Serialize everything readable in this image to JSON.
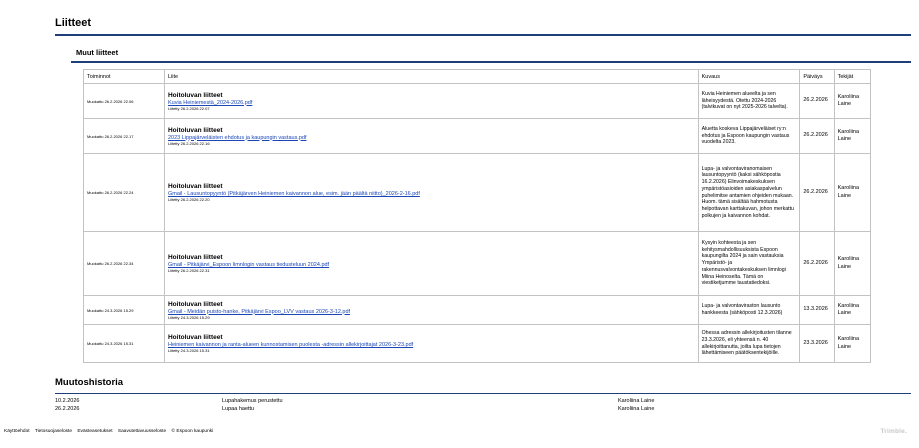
{
  "page": {
    "title": "Liitteet",
    "subtitle": "Muut liitteet"
  },
  "table": {
    "headers": [
      "Toiminnot",
      "Liite",
      "Kuvaus",
      "Päiväys",
      "Tekijät"
    ],
    "rows": [
      {
        "modified": "Muokattu 26.2.2026 22.06",
        "att_title": "Hoitoluvan liitteet",
        "att_link": "Kuvia Heiniemestä_2024-2026.pdf",
        "att_added": "Liitetty 26.2.2026 22.07",
        "desc": "Kuvia Heiniemen alueelta ja sen läheisyydestä. Otettu 2024-2026 (talvikuvat on nyt 2025-2026 talvelta).",
        "date": "26.2.2026",
        "author": "Karoliina Laine"
      },
      {
        "modified": "Muokattu 26.2.2026 22.17",
        "att_title": "Hoitoluvan liitteet",
        "att_link": "2023 Lippajärveläisten ehdotus ja kaupungin vastaus.pdf",
        "att_added": "Liitetty 26.2.2026 22.16",
        "desc": "Aluetta koskeva Lippajärveläiset ry:n ehdotus ja Espoon kaupungin vastaus vuodelta 2023.",
        "date": "26.2.2026",
        "author": "Karoliina Laine"
      },
      {
        "modified": "Muokattu 26.2.2026 22.24",
        "att_title": "Hoitoluvan liitteet",
        "att_link": "Gmail - Lausuntopyyntö (Pitkäjärven Heiniemen kaivannon alue, esim. jään päältä niitto)_2026-2-16.pdf",
        "att_added": "Liitetty 26.2.2026 22.20",
        "desc": "Lupa- ja valvontaviranomaisen lausuntopyyntö (kaksi sähköpostia 16.2.2026) Elinvoimakeskuksen ympäristöasioiden asiakaspalvelun puhelimitse antamien ohjeiden mukaan. Huom. tämä sisältää hahmotusta helpottavan karttakuvan, johon merkattu polkujen ja kaivannon kohdat.",
        "date": "26.2.2026",
        "author": "Karoliina Laine"
      },
      {
        "modified": "Muokattu 26.2.2026 22.34",
        "att_title": "Hoitoluvan liitteet",
        "att_link": "Gmail - Pitkäjärvi_Espoon limnlogin vastaus tiedusteluun 2024.pdf",
        "att_added": "Liitetty 26.2.2026 22.31",
        "desc": "Kysyin kohteesta ja sen kehitysmahdollisuuksista Espoon kaupungilta 2024 ja sain vastauksia Ympäristö- ja rakennusvalvontakeskuksen limnlogi Miina Heinoselta. Tämä on viestiketjumme taustatiedoksi.",
        "date": "26.2.2026",
        "author": "Karoliina Laine"
      },
      {
        "modified": "Muokattu 24.3.2026 15.29",
        "att_title": "Hoitoluvan liitteet",
        "att_link": "Gmail - Meidän puisto-hanke, Pitkäjärvi Espoo_LVV vastaus 2026-3-12.pdf",
        "att_added": "Liitetty 24.3.2026 15.29",
        "desc": "Lupa- ja valvontaviraston lausunto hankkeesta (sähköposti 12.3.2026)",
        "date": "13.3.2026",
        "author": "Karoliina Laine"
      },
      {
        "modified": "Muokattu 24.3.2026 15.31",
        "att_title": "Hoitoluvan liitteet",
        "att_link": "Heiniemen kaivannon ja ranta-alueen kunnostamisen puolesta -adressin allekirjoittajat 2026-3-23.pdf",
        "att_added": "Liitetty 24.3.2026 15.31",
        "desc": "Ohessa adressin allekirjoitusten tilanne 23.3.2026, eli yhteensä n. 40 allekirjoittanutta, joilta lupa tietojen lähettämiseen päätöksentekijöille.",
        "date": "23.3.2026",
        "author": "Karoliina Laine"
      }
    ]
  },
  "history": {
    "title": "Muutoshistoria",
    "rows": [
      {
        "date": "10.2.2026",
        "event": "Lupahakemus perustettu",
        "user": "Karoliina Laine"
      },
      {
        "date": "26.2.2026",
        "event": "Lupaa haettu",
        "user": "Karoliina Laine"
      }
    ]
  },
  "footer": {
    "links": [
      "Käyttöehdot",
      "Tietosuojaseloste",
      "Evästeasetukset",
      "Saavutettavuusseloste",
      "© Espoon kaupunki"
    ],
    "brand": "Trimble."
  }
}
